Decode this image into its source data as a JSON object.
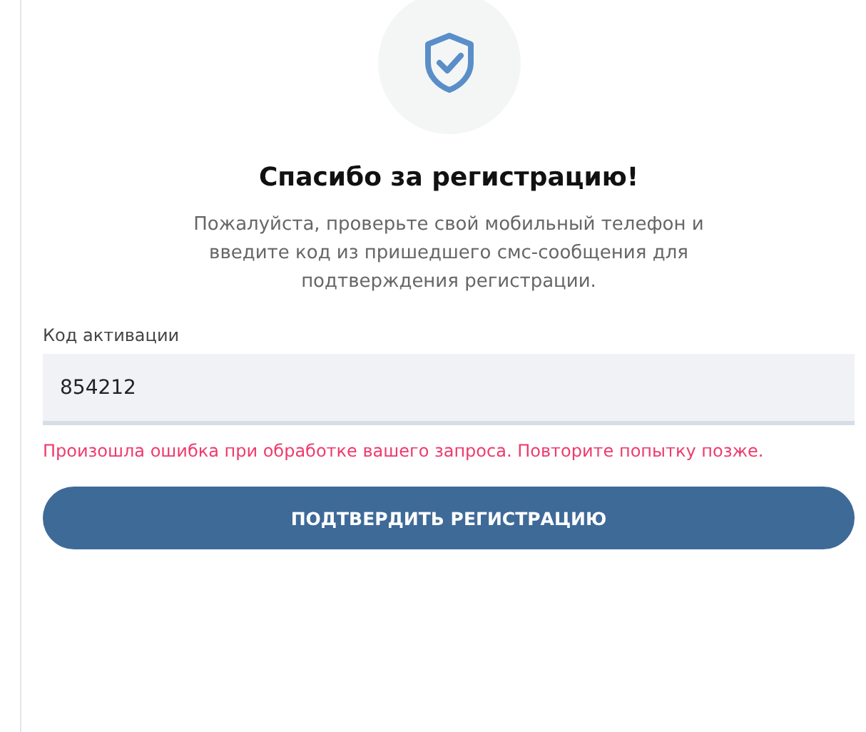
{
  "title": "Спасибо за регистрацию!",
  "description": "Пожалуйста, проверьте свой мобильный телефон и введите код из пришедшего смс-сообщения для подтверждения регистрации.",
  "activation_field": {
    "label": "Код активации",
    "value": "854212"
  },
  "error": "Произошла ошибка при обработке вашего запроса. Повторите попытку позже.",
  "button": "ПОДТВЕРДИТЬ РЕГИСТРАЦИЮ"
}
